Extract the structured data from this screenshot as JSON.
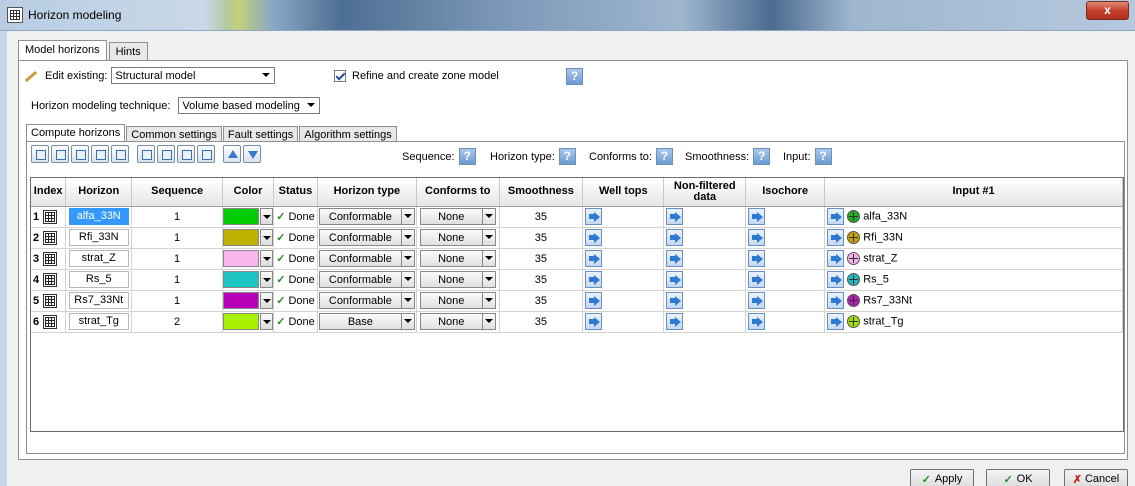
{
  "window": {
    "title": "Horizon modeling",
    "close_label": "x"
  },
  "tabs_top": [
    {
      "label": "Model horizons",
      "active": true
    },
    {
      "label": "Hints",
      "active": false
    }
  ],
  "edit_existing": {
    "label": "Edit existing:",
    "value": "Structural model"
  },
  "refine": {
    "label": "Refine and create zone model",
    "checked": true
  },
  "technique": {
    "label": "Horizon modeling technique:",
    "value": "Volume based modeling"
  },
  "tabs_compute": [
    {
      "label": "Compute horizons",
      "active": true
    },
    {
      "label": "Common settings",
      "active": false
    },
    {
      "label": "Fault settings",
      "active": false
    },
    {
      "label": "Algorithm settings",
      "active": false
    }
  ],
  "help_labels": {
    "sequence": "Sequence:",
    "horizon_type": "Horizon type:",
    "conforms_to": "Conforms to:",
    "smoothness": "Smoothness:",
    "input": "Input:",
    "q": "?"
  },
  "table": {
    "headers": {
      "index": "Index",
      "horizon": "Horizon",
      "sequence": "Sequence",
      "color": "Color",
      "status": "Status",
      "horizon_type": "Horizon type",
      "conforms_to": "Conforms to",
      "smoothness": "Smoothness",
      "well_tops": "Well tops",
      "non_filtered_1": "Non-filtered",
      "non_filtered_2": "data",
      "isochore": "Isochore",
      "input1": "Input #1"
    },
    "rows": [
      {
        "index": "1",
        "horizon": "alfa_33N",
        "sequence": "1",
        "color": "#00cc00",
        "status": "Done",
        "horizon_type": "Conformable",
        "conforms_to": "None",
        "smoothness": "35",
        "input": "alfa_33N",
        "input_color": "#22aa22"
      },
      {
        "index": "2",
        "horizon": "Rfi_33N",
        "sequence": "1",
        "color": "#c0b000",
        "status": "Done",
        "horizon_type": "Conformable",
        "conforms_to": "None",
        "smoothness": "35",
        "input": "Rfi_33N",
        "input_color": "#c8a000"
      },
      {
        "index": "3",
        "horizon": "strat_Z",
        "sequence": "1",
        "color": "#f8b4ec",
        "status": "Done",
        "horizon_type": "Conformable",
        "conforms_to": "None",
        "smoothness": "35",
        "input": "strat_Z",
        "input_color": "#f4b0e8"
      },
      {
        "index": "4",
        "horizon": "Rs_5",
        "sequence": "1",
        "color": "#1cc4c4",
        "status": "Done",
        "horizon_type": "Conformable",
        "conforms_to": "None",
        "smoothness": "35",
        "input": "Rs_5",
        "input_color": "#20b8c0"
      },
      {
        "index": "5",
        "horizon": "Rs7_33Nt",
        "sequence": "1",
        "color": "#b800b8",
        "status": "Done",
        "horizon_type": "Conformable",
        "conforms_to": "None",
        "smoothness": "35",
        "input": "Rs7_33Nt",
        "input_color": "#b020b0"
      },
      {
        "index": "6",
        "horizon": "strat_Tg",
        "sequence": "2",
        "color": "#a8f000",
        "status": "Done",
        "horizon_type": "Base",
        "conforms_to": "None",
        "smoothness": "35",
        "input": "strat_Tg",
        "input_color": "#a0e000"
      }
    ]
  },
  "buttons": {
    "apply": "Apply",
    "ok": "OK",
    "cancel": "Cancel",
    "check": "✓",
    "x": "✗"
  }
}
